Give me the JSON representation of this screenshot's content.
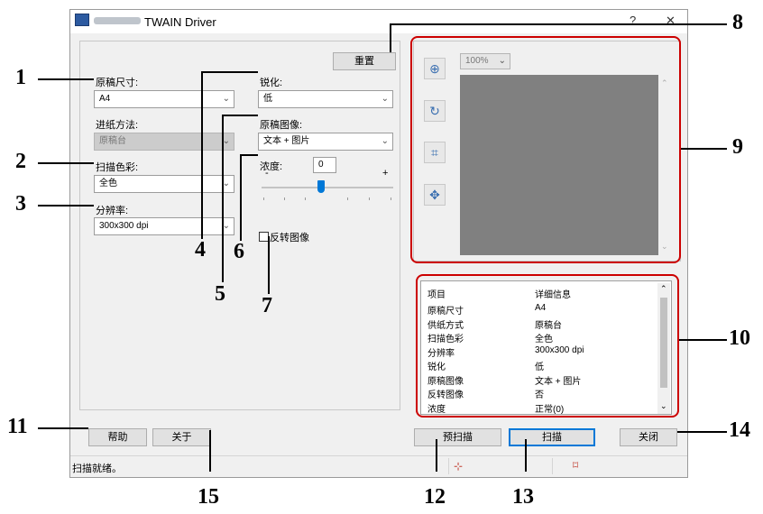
{
  "window": {
    "title": "TWAIN Driver",
    "help_glyph": "?",
    "close_glyph": "✕"
  },
  "left": {
    "reset_label": "重置",
    "original_size": {
      "label": "原稿尺寸:",
      "value": "A4"
    },
    "feed_method": {
      "label": "进纸方法:",
      "value": "原稿台"
    },
    "scan_color": {
      "label": "扫描色彩:",
      "value": "全色"
    },
    "resolution": {
      "label": "分辨率:",
      "value": "300x300 dpi"
    },
    "sharpen": {
      "label": "锐化:",
      "value": "低"
    },
    "original_image": {
      "label": "原稿图像:",
      "value": "文本 + 图片"
    },
    "density": {
      "label": "浓度:",
      "value": "0",
      "minus": "-",
      "plus": "+",
      "level": 0.45
    },
    "invert": {
      "label": "反转图像",
      "checked": false
    }
  },
  "preview": {
    "zoom_value": "100%"
  },
  "details": {
    "header_item": "项目",
    "header_detail": "详细信息",
    "rows": [
      {
        "item": "原稿尺寸",
        "detail": "A4"
      },
      {
        "item": "供纸方式",
        "detail": "原稿台"
      },
      {
        "item": "扫描色彩",
        "detail": "全色"
      },
      {
        "item": "分辨率",
        "detail": "300x300 dpi"
      },
      {
        "item": "锐化",
        "detail": "低"
      },
      {
        "item": "原稿图像",
        "detail": "文本 + 图片"
      },
      {
        "item": "反转图像",
        "detail": "否"
      },
      {
        "item": "浓度",
        "detail": "正常(0)"
      }
    ]
  },
  "buttons": {
    "help": "帮助",
    "about": "关于",
    "prescan": "预扫描",
    "scan": "扫描",
    "close": "关闭"
  },
  "status": {
    "text": "扫描就绪。"
  },
  "callouts": [
    "1",
    "2",
    "3",
    "4",
    "5",
    "6",
    "7",
    "8",
    "9",
    "10",
    "11",
    "12",
    "13",
    "14",
    "15"
  ],
  "colors": {
    "accent": "#0078d7",
    "callout_frame": "#cc0000",
    "preview_gray": "#808080"
  }
}
